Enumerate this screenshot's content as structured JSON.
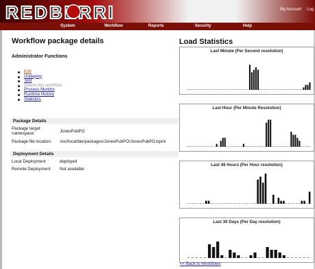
{
  "header": {
    "logo_text": "REDBERRI",
    "top_links": [
      "My Account",
      "Log"
    ]
  },
  "nav": [
    "System",
    "Workflow",
    "Reports",
    "Security",
    "Help"
  ],
  "left": {
    "page_title": "Workflow package details",
    "admin_title": "Administrator Functions",
    "links": [
      {
        "label": "Edit",
        "state": "active"
      },
      {
        "label": "Undeploy",
        "state": "link"
      },
      {
        "label": "Test",
        "state": "link"
      },
      {
        "label": "Delete this workflow",
        "state": "disabled"
      },
      {
        "label": "Process Monitor",
        "state": "link"
      },
      {
        "label": "Runtime History",
        "state": "link"
      },
      {
        "label": "Statistics",
        "state": "link"
      }
    ],
    "package_details": {
      "heading": "Package Details",
      "target_label": "Package target namespace:",
      "target_value": "JonesPubPO",
      "file_label": "Package file location:",
      "file_value": "/usr/local/bie/packages/JonesPubPO/JonesPubPO.bpml"
    },
    "deployment_details": {
      "heading": "Deployment Details",
      "local_label": "Local Deployment",
      "local_value": "deployed",
      "remote_label": "Remote Deployment",
      "remote_value": "Not available"
    }
  },
  "right": {
    "title": "Load Statistics",
    "back_link": "<< Back to Workflows"
  },
  "chart_data": [
    {
      "type": "bar",
      "title": "Last Minute (Per Second resolution)",
      "x": [
        0,
        1,
        2,
        3,
        4,
        5,
        6,
        7,
        8,
        9,
        10,
        11,
        12,
        13,
        14,
        15,
        16,
        17,
        18,
        19,
        20,
        21,
        22,
        23,
        24,
        25,
        26,
        27,
        28,
        29,
        30,
        31,
        32,
        33,
        34,
        35,
        36,
        37,
        38,
        39,
        40,
        41,
        42,
        43,
        44,
        45,
        46,
        47,
        48,
        49,
        50,
        51,
        52,
        53,
        54,
        55,
        56,
        57,
        58,
        59
      ],
      "values": [
        0,
        0,
        0,
        0,
        0,
        0,
        0,
        0,
        0,
        0,
        0,
        0,
        0,
        0,
        0,
        0,
        0,
        0,
        0,
        0,
        0,
        0,
        0,
        0,
        0,
        0,
        0,
        0,
        0,
        0,
        10,
        7,
        8,
        9,
        8,
        0,
        0,
        0,
        0,
        0,
        0,
        0,
        0,
        0,
        0,
        0,
        0,
        0,
        0,
        0,
        0,
        0,
        0,
        0,
        0,
        0,
        1,
        2,
        2,
        3
      ],
      "ylim": [
        0,
        12
      ]
    },
    {
      "type": "bar",
      "title": "Last Hour (Per Minute Resolution)",
      "x": [
        0,
        1,
        2,
        3,
        4,
        5,
        6,
        7,
        8,
        9,
        10,
        11,
        12,
        13,
        14,
        15,
        16,
        17,
        18,
        19,
        20,
        21,
        22,
        23,
        24,
        25,
        26,
        27,
        28,
        29,
        30,
        31,
        32,
        33,
        34,
        35,
        36,
        37,
        38,
        39,
        40,
        41,
        42,
        43,
        44,
        45,
        46,
        47,
        48,
        49,
        50,
        51,
        52,
        53,
        54,
        55,
        56,
        57,
        58,
        59
      ],
      "values": [
        0,
        0,
        0,
        0,
        0,
        0,
        0,
        0,
        0,
        0,
        0,
        0,
        0,
        0,
        1,
        0,
        2,
        3,
        3,
        0,
        0,
        0,
        0,
        0,
        0,
        0,
        0,
        1,
        0,
        0,
        0,
        0,
        0,
        0,
        0,
        0,
        0,
        0,
        8,
        9,
        9,
        0,
        0,
        0,
        0,
        0,
        0,
        0,
        0,
        0,
        5,
        4,
        4,
        3,
        2,
        0,
        0,
        0,
        0,
        0
      ],
      "ylim": [
        0,
        10
      ]
    },
    {
      "type": "bar",
      "title": "Last 48 Hours (Per Hour resolution)",
      "x": [
        0,
        1,
        2,
        3,
        4,
        5,
        6,
        7,
        8,
        9,
        10,
        11,
        12,
        13,
        14,
        15,
        16,
        17,
        18,
        19,
        20,
        21,
        22,
        23,
        24,
        25,
        26,
        27,
        28,
        29,
        30,
        31,
        32,
        33,
        34,
        35,
        36,
        37,
        38,
        39,
        40,
        41,
        42,
        43,
        44,
        45,
        46,
        47
      ],
      "values": [
        0,
        0,
        0,
        0,
        0,
        0,
        0,
        1,
        1,
        0,
        0,
        0,
        0,
        0,
        0,
        0,
        0,
        0,
        0,
        0,
        0,
        0,
        0,
        0,
        0,
        0,
        0,
        8,
        9,
        7,
        10,
        0,
        0,
        3,
        0,
        2,
        1,
        1,
        0,
        0,
        0,
        0,
        0,
        0,
        1,
        1,
        0,
        4
      ],
      "ylim": [
        0,
        10
      ]
    },
    {
      "type": "bar",
      "title": "Last 30 Days (Per Day resolution)",
      "x": [
        1,
        2,
        3,
        4,
        5,
        6,
        7,
        8,
        9,
        10,
        11,
        12,
        13,
        14,
        15,
        16,
        17,
        18,
        19,
        20,
        21,
        22,
        23,
        24,
        25,
        26,
        27,
        28,
        29,
        30
      ],
      "values": [
        0,
        0,
        0,
        0,
        0,
        5,
        4,
        6,
        1,
        0,
        3,
        2,
        1,
        0,
        0,
        1,
        2,
        0,
        0,
        4,
        3,
        3,
        2,
        1,
        0,
        0,
        0,
        0,
        0,
        0
      ],
      "ylim": [
        0,
        10
      ]
    }
  ]
}
